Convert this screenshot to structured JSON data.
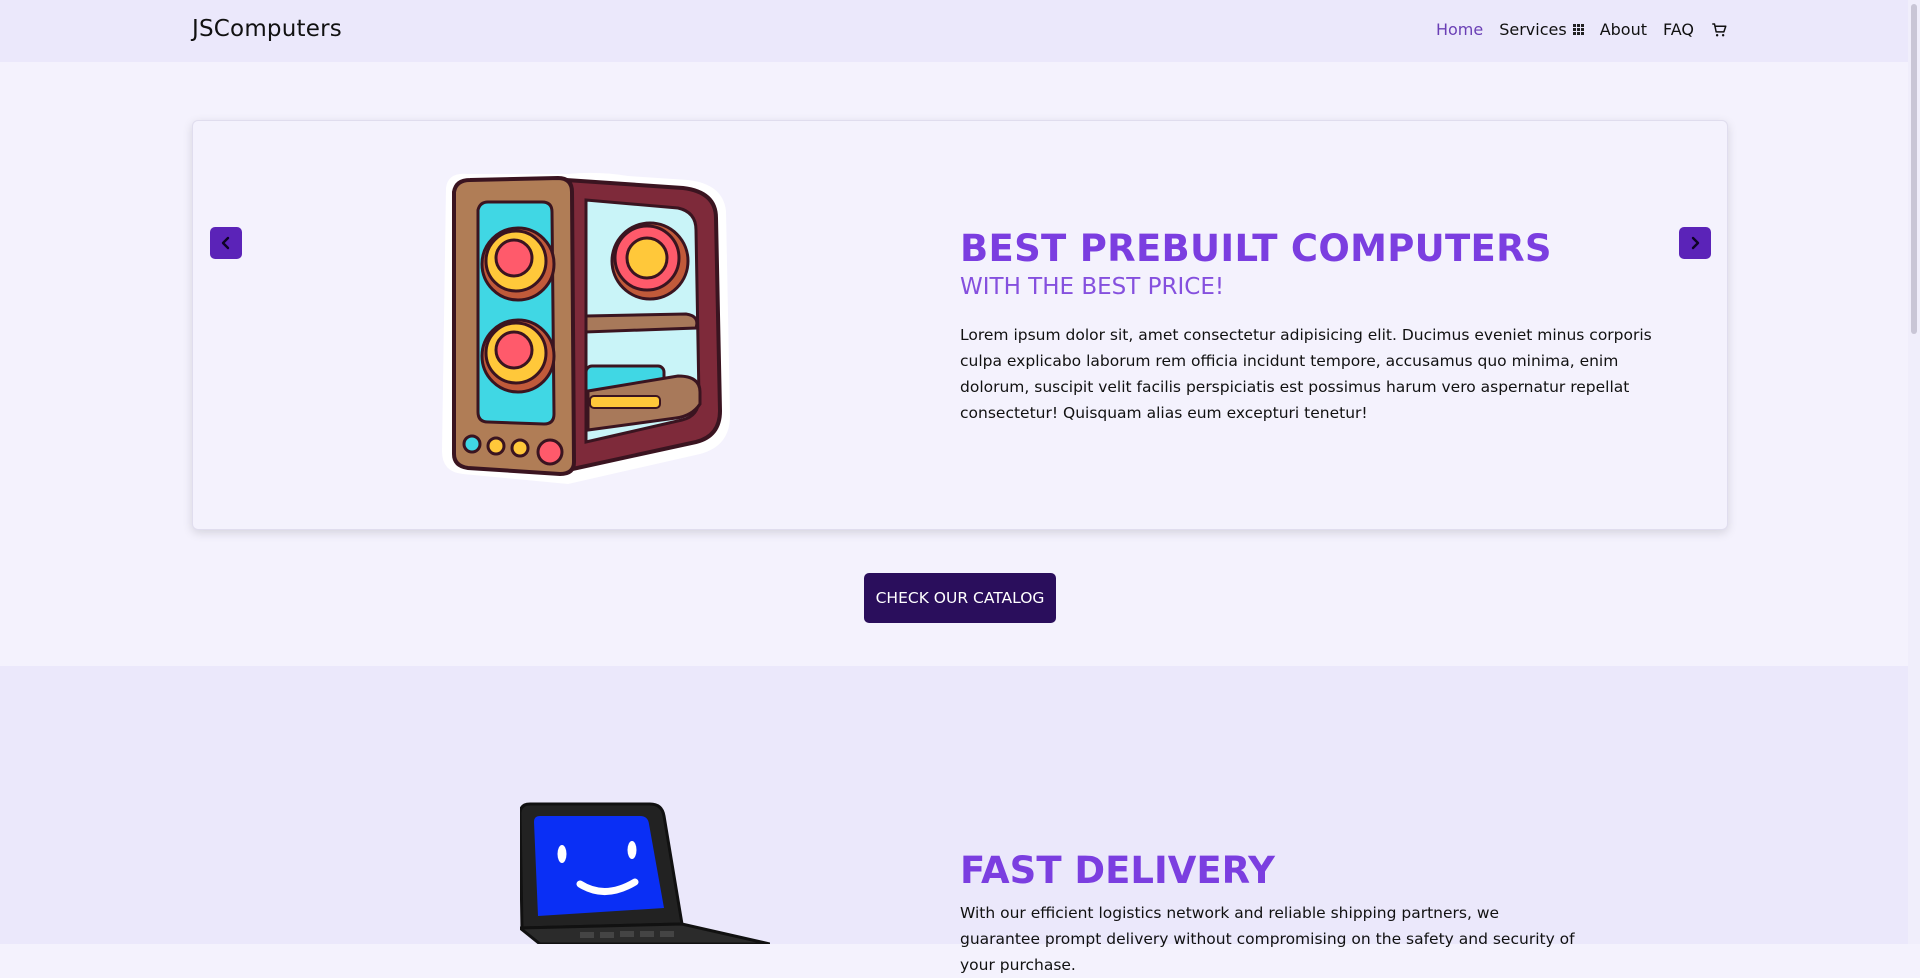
{
  "navbar": {
    "brand": "JSComputers",
    "links": [
      "Home",
      "Services",
      "About",
      "FAQ"
    ]
  },
  "carousel": {
    "title": "BEST PREBUILT COMPUTERS",
    "subtitle": "WITH THE BEST PRICE!",
    "body": "Lorem ipsum dolor sit, amet consectetur adipisicing elit. Ducimus eveniet minus corporis culpa explicabo laborum rem officia incidunt tempore, accusamus quo minima, enim dolorum, suscipit velit facilis perspiciatis est possimus harum vero aspernatur repellat consectetur! Quisquam alias eum excepturi tenetur!"
  },
  "cta": {
    "label": "CHECK OUR CATALOG"
  },
  "delivery": {
    "title": "FAST DELIVERY",
    "body": "With our efficient logistics network and reliable shipping partners, we guarantee prompt delivery without compromising on the safety and security of your purchase."
  },
  "icons": {
    "services": "grid-icon",
    "cart": "cart-icon",
    "prev": "chevron-left-icon",
    "next": "chevron-right-icon"
  },
  "colors": {
    "accent": "#7b3ee0",
    "nav_active": "#6a3fb5",
    "cta_bg": "#2a0e5c",
    "carousel_button": "#5b23b8"
  }
}
